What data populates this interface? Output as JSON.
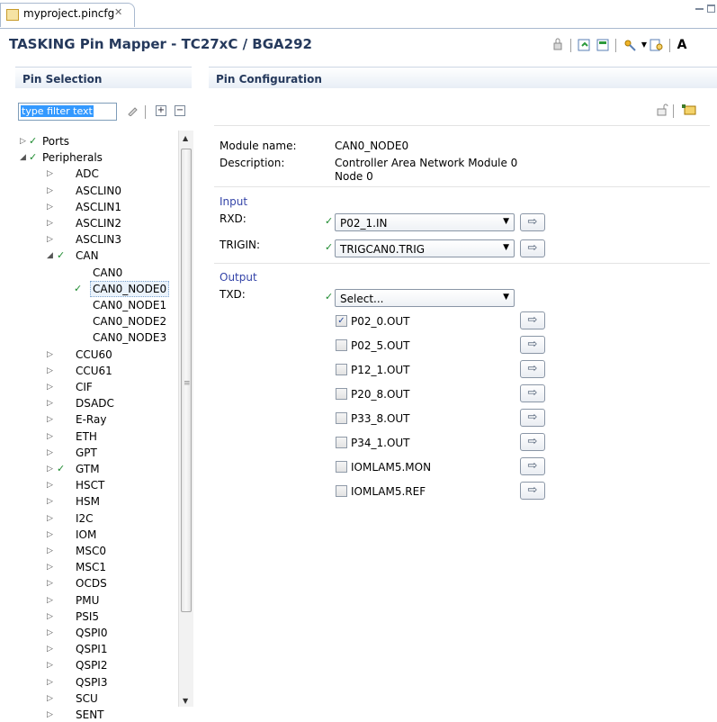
{
  "tab": {
    "title": "myproject.pincfg",
    "close_glyph": "✕"
  },
  "editor": {
    "title": "TASKING Pin Mapper - TC27xC / BGA292"
  },
  "toolbar": {
    "icons": [
      "lock-icon",
      "refresh-config-icon",
      "export-icon",
      "wizard-icon",
      "dropdown-icon",
      "search-config-icon",
      "font-icon"
    ],
    "font_icon_glyph": "A"
  },
  "pin_selection": {
    "header": "Pin Selection",
    "filter_text": "type filter text",
    "tree": [
      {
        "label": "Ports",
        "level": 0,
        "expanded": false,
        "checked": true,
        "has_children": true
      },
      {
        "label": "Peripherals",
        "level": 0,
        "expanded": true,
        "checked": true,
        "has_children": true
      },
      {
        "label": "ADC",
        "level": 1,
        "expanded": false,
        "checked": false,
        "has_children": true
      },
      {
        "label": "ASCLIN0",
        "level": 1,
        "expanded": false,
        "checked": false,
        "has_children": true
      },
      {
        "label": "ASCLIN1",
        "level": 1,
        "expanded": false,
        "checked": false,
        "has_children": true
      },
      {
        "label": "ASCLIN2",
        "level": 1,
        "expanded": false,
        "checked": false,
        "has_children": true
      },
      {
        "label": "ASCLIN3",
        "level": 1,
        "expanded": false,
        "checked": false,
        "has_children": true
      },
      {
        "label": "CAN",
        "level": 1,
        "expanded": true,
        "checked": true,
        "has_children": true
      },
      {
        "label": "CAN0",
        "level": 2,
        "expanded": false,
        "checked": false,
        "has_children": false
      },
      {
        "label": "CAN0_NODE0",
        "level": 2,
        "expanded": false,
        "checked": true,
        "has_children": false,
        "selected": true
      },
      {
        "label": "CAN0_NODE1",
        "level": 2,
        "expanded": false,
        "checked": false,
        "has_children": false
      },
      {
        "label": "CAN0_NODE2",
        "level": 2,
        "expanded": false,
        "checked": false,
        "has_children": false
      },
      {
        "label": "CAN0_NODE3",
        "level": 2,
        "expanded": false,
        "checked": false,
        "has_children": false
      },
      {
        "label": "CCU60",
        "level": 1,
        "expanded": false,
        "checked": false,
        "has_children": true
      },
      {
        "label": "CCU61",
        "level": 1,
        "expanded": false,
        "checked": false,
        "has_children": true
      },
      {
        "label": "CIF",
        "level": 1,
        "expanded": false,
        "checked": false,
        "has_children": true
      },
      {
        "label": "DSADC",
        "level": 1,
        "expanded": false,
        "checked": false,
        "has_children": true
      },
      {
        "label": "E-Ray",
        "level": 1,
        "expanded": false,
        "checked": false,
        "has_children": true
      },
      {
        "label": "ETH",
        "level": 1,
        "expanded": false,
        "checked": false,
        "has_children": true
      },
      {
        "label": "GPT",
        "level": 1,
        "expanded": false,
        "checked": false,
        "has_children": true
      },
      {
        "label": "GTM",
        "level": 1,
        "expanded": false,
        "checked": true,
        "has_children": true
      },
      {
        "label": "HSCT",
        "level": 1,
        "expanded": false,
        "checked": false,
        "has_children": true
      },
      {
        "label": "HSM",
        "level": 1,
        "expanded": false,
        "checked": false,
        "has_children": true
      },
      {
        "label": "I2C",
        "level": 1,
        "expanded": false,
        "checked": false,
        "has_children": true
      },
      {
        "label": "IOM",
        "level": 1,
        "expanded": false,
        "checked": false,
        "has_children": true
      },
      {
        "label": "MSC0",
        "level": 1,
        "expanded": false,
        "checked": false,
        "has_children": true
      },
      {
        "label": "MSC1",
        "level": 1,
        "expanded": false,
        "checked": false,
        "has_children": true
      },
      {
        "label": "OCDS",
        "level": 1,
        "expanded": false,
        "checked": false,
        "has_children": true
      },
      {
        "label": "PMU",
        "level": 1,
        "expanded": false,
        "checked": false,
        "has_children": true
      },
      {
        "label": "PSI5",
        "level": 1,
        "expanded": false,
        "checked": false,
        "has_children": true
      },
      {
        "label": "QSPI0",
        "level": 1,
        "expanded": false,
        "checked": false,
        "has_children": true
      },
      {
        "label": "QSPI1",
        "level": 1,
        "expanded": false,
        "checked": false,
        "has_children": true
      },
      {
        "label": "QSPI2",
        "level": 1,
        "expanded": false,
        "checked": false,
        "has_children": true
      },
      {
        "label": "QSPI3",
        "level": 1,
        "expanded": false,
        "checked": false,
        "has_children": true
      },
      {
        "label": "SCU",
        "level": 1,
        "expanded": false,
        "checked": false,
        "has_children": true
      },
      {
        "label": "SENT",
        "level": 1,
        "expanded": false,
        "checked": false,
        "has_children": true
      }
    ]
  },
  "pin_config": {
    "header": "Pin Configuration",
    "module_name_label": "Module name:",
    "module_name_value": "CAN0_NODE0",
    "description_label": "Description:",
    "description_line1": "Controller Area Network Module 0",
    "description_line2": "Node 0",
    "input_group": "Input",
    "rxd_label": "RXD:",
    "rxd_value": "P02_1.IN",
    "trigin_label": "TRIGIN:",
    "trigin_value": "TRIGCAN0.TRIG",
    "output_group": "Output",
    "txd_label": "TXD:",
    "txd_value": "Select...",
    "txd_options": [
      {
        "label": "P02_0.OUT",
        "checked": true
      },
      {
        "label": "P02_5.OUT",
        "checked": false
      },
      {
        "label": "P12_1.OUT",
        "checked": false
      },
      {
        "label": "P20_8.OUT",
        "checked": false
      },
      {
        "label": "P33_8.OUT",
        "checked": false
      },
      {
        "label": "P34_1.OUT",
        "checked": false
      },
      {
        "label": "IOMLAM5.MON",
        "checked": false
      },
      {
        "label": "IOMLAM5.REF",
        "checked": false
      }
    ],
    "colors": {
      "group_label": "#3444a8",
      "check": "#1c8a2e",
      "header_text": "#25395c"
    }
  }
}
